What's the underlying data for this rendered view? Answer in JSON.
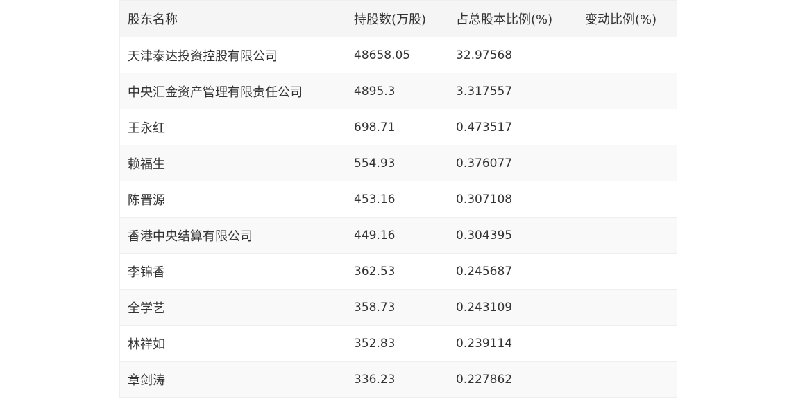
{
  "table": {
    "headers": [
      "股东名称",
      "持股数(万股)",
      "占总股本比例(%)",
      "变动比例(%)"
    ],
    "rows": [
      [
        "天津泰达投资控股有限公司",
        "48658.05",
        "32.97568",
        ""
      ],
      [
        "中央汇金资产管理有限责任公司",
        "4895.3",
        "3.317557",
        ""
      ],
      [
        "王永红",
        "698.71",
        "0.473517",
        ""
      ],
      [
        "赖福生",
        "554.93",
        "0.376077",
        ""
      ],
      [
        "陈晋源",
        "453.16",
        "0.307108",
        ""
      ],
      [
        "香港中央结算有限公司",
        "449.16",
        "0.304395",
        ""
      ],
      [
        "李锦香",
        "362.53",
        "0.245687",
        ""
      ],
      [
        "全学艺",
        "358.73",
        "0.243109",
        ""
      ],
      [
        "林祥如",
        "352.83",
        "0.239114",
        ""
      ],
      [
        "章剑涛",
        "336.23",
        "0.227862",
        ""
      ]
    ]
  }
}
